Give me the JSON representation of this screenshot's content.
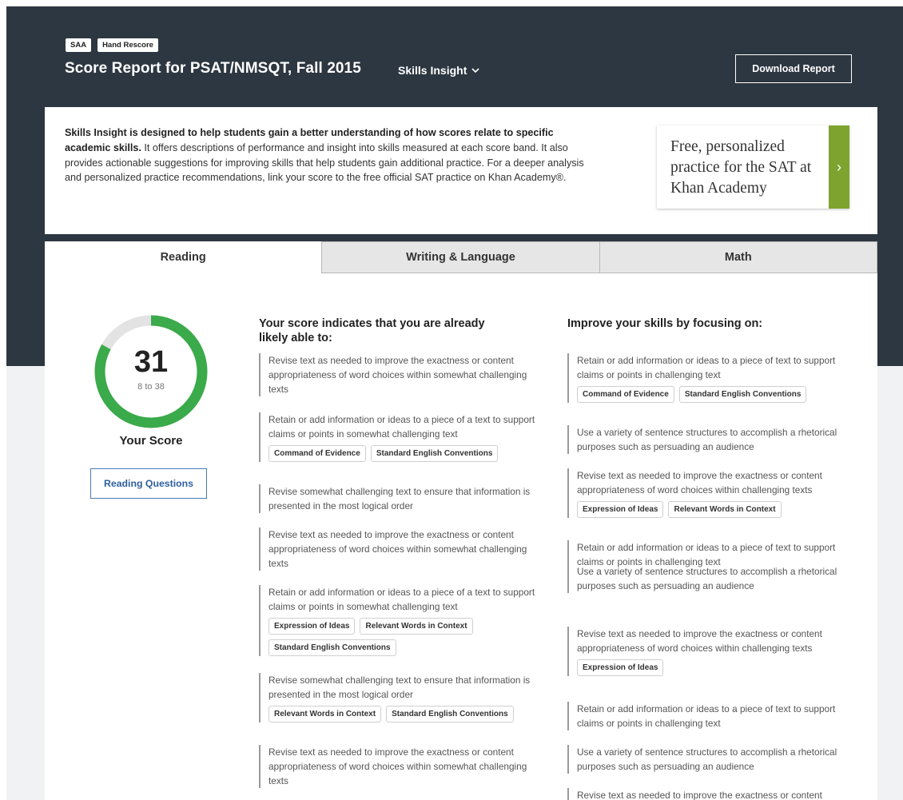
{
  "header": {
    "badges": [
      "SAA",
      "Hand Rescore"
    ],
    "title": "Score Report for PSAT/NMSQT, Fall 2015",
    "view_dropdown": "Skills Insight",
    "download_label": "Download Report"
  },
  "intro": {
    "bold_lead": "Skills Insight is designed to help students gain a better understanding of how scores relate to specific academic skills.",
    "body": " It offers descriptions of performance and insight into skills measured at each score band.  It also provides actionable suggestions for improving skills that help students gain additional practice.  For a deeper analysis and personalized practice recommendations, link your score to the free official SAT practice on Khan Academy®.",
    "khan_promo": "Free, personalized practice for the SAT at Khan Academy",
    "khan_arrow": "›"
  },
  "tabs": [
    {
      "label": "Reading",
      "active": true
    },
    {
      "label": "Writing & Language",
      "active": false
    },
    {
      "label": "Math",
      "active": false
    }
  ],
  "score": {
    "value": "31",
    "range": "8 to 38",
    "label": "Your Score",
    "fill_fraction": 0.83,
    "ring_color": "#3aaa4a",
    "track_color": "#e3e3e3",
    "questions_button": "Reading Questions"
  },
  "able_to": {
    "heading": "Your score indicates that you are already likely able to:",
    "items": [
      {
        "text": "Revise text as needed to improve the exactness or content appropriateness of word choices within somewhat challenging texts",
        "chips": []
      },
      {
        "text": "Retain or add information or ideas to a piece of a text to support claims or points in somewhat challenging text",
        "chips": [
          "Command of Evidence",
          "Standard English Conventions"
        ]
      },
      {
        "text": "Revise somewhat challenging text to ensure that information is presented in the most logical order",
        "chips": []
      },
      {
        "text": "Revise text as needed to improve the exactness or content appropriateness of word choices within somewhat challenging texts",
        "chips": []
      },
      {
        "text": "Retain or add information or ideas to a piece of a text to support claims or points in somewhat challenging text",
        "chips": [
          "Expression of Ideas",
          "Relevant Words in Context",
          "Standard English Conventions"
        ]
      },
      {
        "text": "Revise somewhat challenging text to ensure that information is presented in the most logical order",
        "chips": [
          "Relevant Words in Context",
          "Standard English Conventions"
        ]
      },
      {
        "text": "Revise text as needed to improve the exactness or content appropriateness of word choices within somewhat challenging texts",
        "chips": []
      }
    ]
  },
  "improve": {
    "heading": "Improve your skills by focusing on:",
    "items": [
      {
        "text": "Retain or add information or ideas to a piece of text to support claims or points in challenging text",
        "chips": [
          "Command of Evidence",
          "Standard English Conventions"
        ]
      },
      {
        "text": "Use a variety of sentence structures to accomplish a rhetorical purposes such as persuading an audience",
        "chips": []
      },
      {
        "text": "Revise text as needed to improve the exactness or content appropriateness of word choices within challenging texts",
        "chips": [
          "Expression of Ideas",
          "Relevant Words in Context"
        ]
      },
      {
        "text": "Retain or add information or ideas to a piece of text to support claims or points in challenging text",
        "chips": []
      },
      {
        "text": "Use a variety of sentence structures to accomplish a rhetorical purposes such as persuading an audience",
        "chips": []
      },
      {
        "text": "Revise text as needed to improve the exactness or content appropriateness of word choices within challenging texts",
        "chips": [
          "Expression of Ideas"
        ]
      },
      {
        "text": "Retain or add information or ideas to a piece of text to support claims or points in challenging text",
        "chips": []
      },
      {
        "text": "Use a variety of sentence structures to accomplish a rhetorical purposes such as persuading an audience",
        "chips": []
      },
      {
        "text": "Revise text as needed to improve the exactness or content",
        "chips": []
      }
    ]
  }
}
